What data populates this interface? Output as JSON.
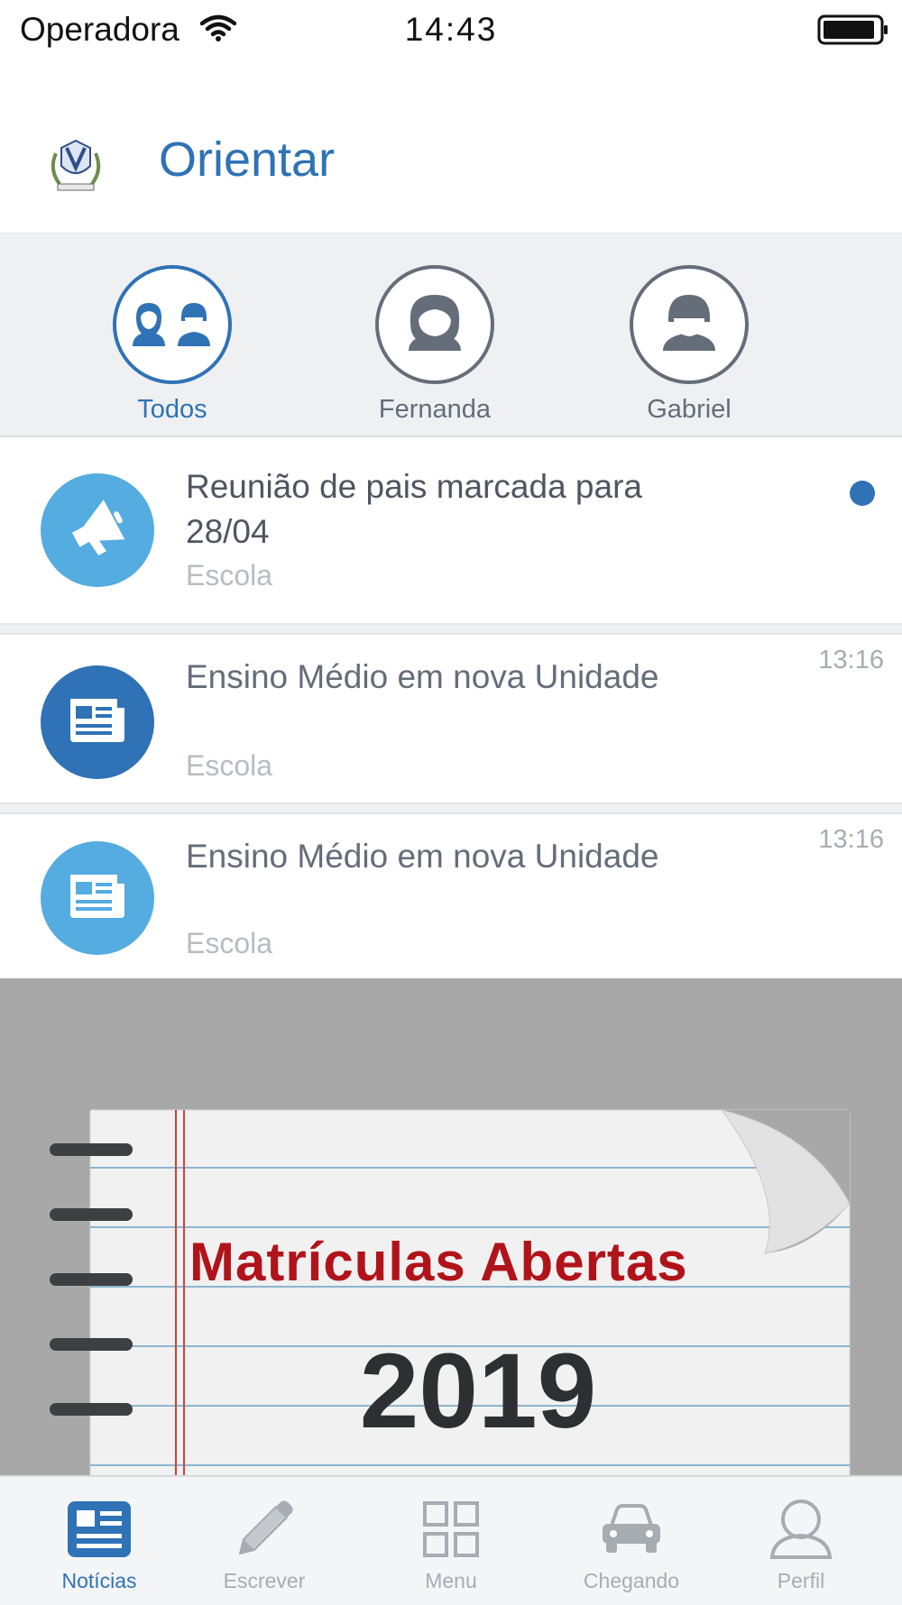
{
  "status_bar": {
    "carrier": "Operadora",
    "time": "14:43"
  },
  "header": {
    "title": "Orientar"
  },
  "profiles": [
    {
      "label": "Todos",
      "icon": "two-people-icon",
      "active": true
    },
    {
      "label": "Fernanda",
      "icon": "girl-avatar-icon",
      "active": false
    },
    {
      "label": "Gabriel",
      "icon": "boy-avatar-icon",
      "active": false
    }
  ],
  "feed": [
    {
      "title": "Reunião de pais marcada para 28/04",
      "source": "Escola",
      "time": "",
      "icon": "megaphone-icon",
      "icon_color": "#54ace0",
      "unread": true
    },
    {
      "title": "Ensino Médio em nova Unidade",
      "source": "Escola",
      "time": "13:16",
      "icon": "newspaper-icon",
      "icon_color": "#2f72b6",
      "unread": false
    },
    {
      "title": "Ensino Médio em nova Unidade",
      "source": "Escola",
      "time": "13:16",
      "icon": "newspaper-icon",
      "icon_color": "#54ace0",
      "unread": false
    }
  ],
  "banner": {
    "headline": "Matrículas Abertas",
    "year": "2019"
  },
  "tabs": [
    {
      "label": "Notícias",
      "icon": "news-icon",
      "active": true
    },
    {
      "label": "Escrever",
      "icon": "pencil-icon",
      "active": false
    },
    {
      "label": "Menu",
      "icon": "grid-icon",
      "active": false
    },
    {
      "label": "Chegando",
      "icon": "car-icon",
      "active": false
    },
    {
      "label": "Perfil",
      "icon": "person-icon",
      "active": false
    }
  ],
  "colors": {
    "accent": "#2f72b6",
    "light_accent": "#54ace0",
    "unread_dot": "#2f72b6",
    "banner_text": "#b0141a"
  }
}
